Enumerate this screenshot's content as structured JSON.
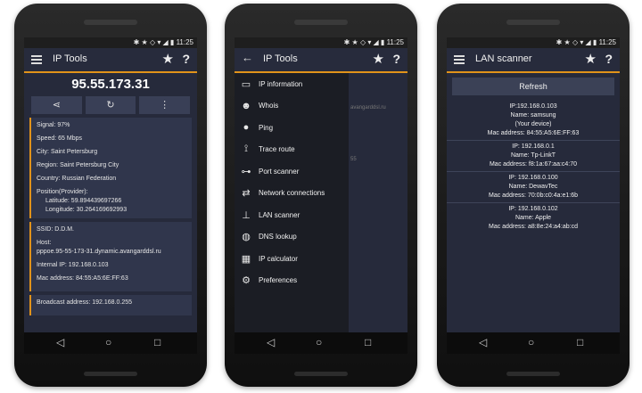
{
  "status_time": "11:25",
  "phone1": {
    "title": "IP Tools",
    "ip": "95.55.173.31",
    "info": {
      "signal": "Signal: 97%",
      "speed": "Speed: 65 Mbps",
      "city": "City: Saint Petersburg",
      "region": "Region: Saint Petersburg City",
      "country": "Country: Russian Federation",
      "position": "Position(Provider):",
      "latitude": "Latitude: 59.894439697266",
      "longitude": "Longitude: 30.264169692993"
    },
    "net": {
      "ssid": "SSID: D.D.M.",
      "host_label": "Host:",
      "host": "pppoe.95-55-173-31.dynamic.avangarddsl.ru",
      "internal_ip": "Internal IP: 192.168.0.103",
      "mac": "Mac address: 84:55:A5:6E:FF:63"
    },
    "broadcast": "Broadcast address: 192.168.0.255"
  },
  "phone2": {
    "title": "IP Tools",
    "behind_text": "avangarddsl.ru",
    "behind_text2": "55",
    "menu": [
      {
        "label": "IP information",
        "icon": "monitor-icon"
      },
      {
        "label": "Whois",
        "icon": "person-icon"
      },
      {
        "label": "Ping",
        "icon": "ping-pong-icon"
      },
      {
        "label": "Trace route",
        "icon": "route-icon"
      },
      {
        "label": "Port scanner",
        "icon": "network-icon"
      },
      {
        "label": "Network connections",
        "icon": "connections-icon"
      },
      {
        "label": "LAN scanner",
        "icon": "lan-icon"
      },
      {
        "label": "DNS lookup",
        "icon": "globe-icon"
      },
      {
        "label": "IP calculator",
        "icon": "calculator-icon"
      },
      {
        "label": "Preferences",
        "icon": "gear-icon"
      }
    ]
  },
  "phone3": {
    "title": "LAN scanner",
    "refresh": "Refresh",
    "devices": [
      {
        "ip": "IP:192.168.0.103",
        "name": "Name: samsung",
        "note": "(Your device)",
        "mac": "Mac address: 84:55:A5:6E:FF:63"
      },
      {
        "ip": "IP: 192.168.0.1",
        "name": "Name: Tp-LinkT",
        "note": "",
        "mac": "Mac address: f8:1a:67:aa:c4:70"
      },
      {
        "ip": "IP: 192.168.0.100",
        "name": "Name: DewavTec",
        "note": "",
        "mac": "Mac address: 70:0b:c0:4a:e1:6b"
      },
      {
        "ip": "IP: 192.168.0.102",
        "name": "Name: Apple",
        "note": "",
        "mac": "Mac address: a8:8e:24:a4:ab:cd"
      }
    ]
  },
  "colors": {
    "accent": "#e1931a",
    "bg": "#262a3b"
  }
}
